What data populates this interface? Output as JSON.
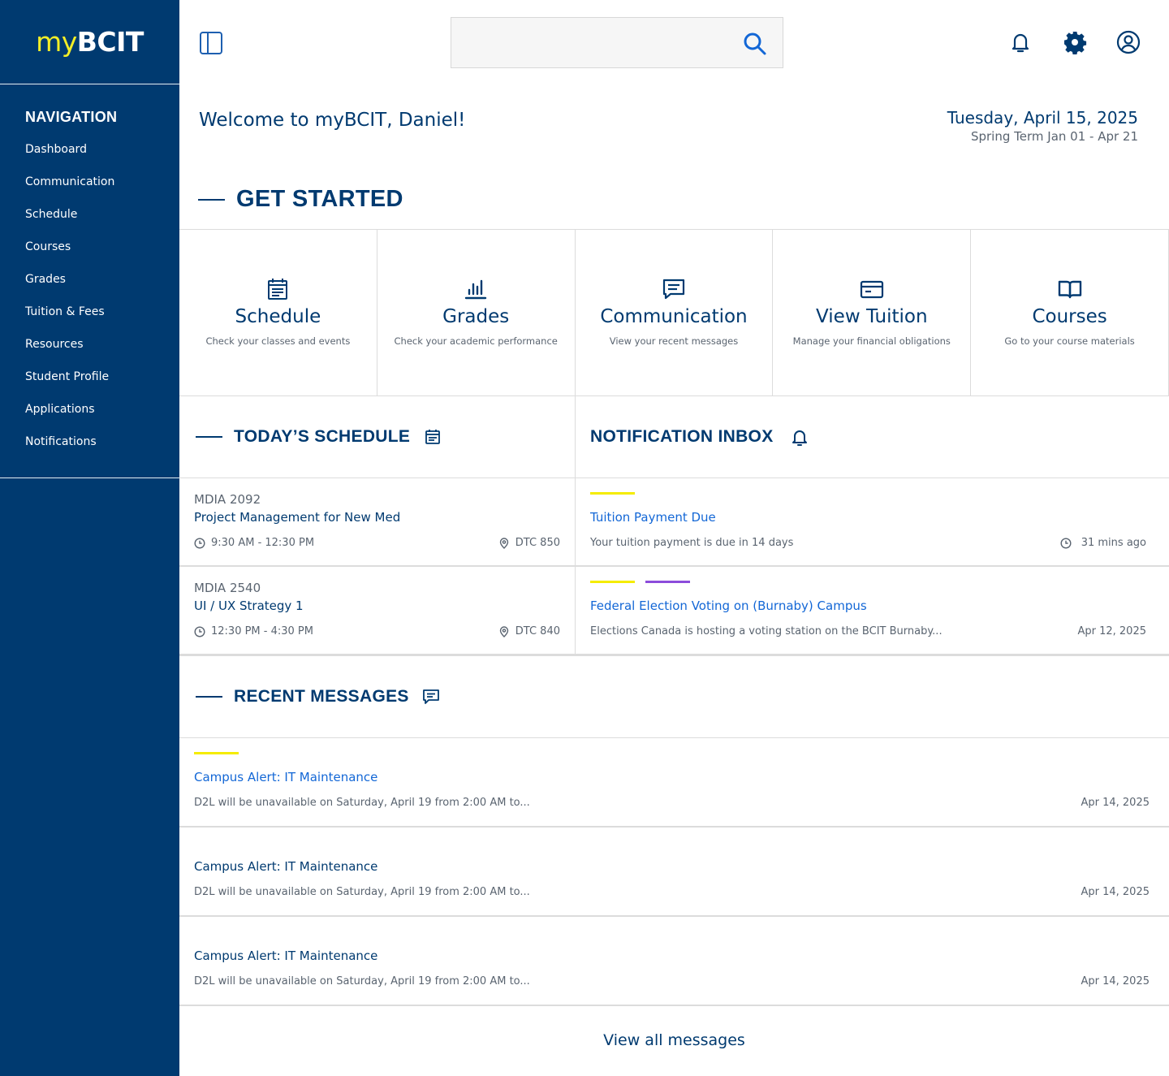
{
  "logo": {
    "my": "my",
    "bcit": "BCIT"
  },
  "nav": {
    "title": "NAVIGATION",
    "items": [
      "Dashboard",
      "Communication",
      "Schedule",
      "Courses",
      "Grades",
      "Tuition & Fees",
      "Resources",
      "Student Profile",
      "Applications",
      "Notifications"
    ]
  },
  "header": {
    "search_placeholder": "",
    "icons": [
      "sidebar-toggle-icon",
      "search-icon",
      "bell-icon",
      "gear-icon",
      "account-icon"
    ]
  },
  "welcome": "Welcome to myBCIT, Daniel!",
  "date": {
    "main": "Tuesday, April  15, 2025",
    "term": "Spring Term Jan 01 - Apr 21"
  },
  "get_started": {
    "title": "GET STARTED",
    "cards": [
      {
        "title": "Schedule",
        "subtitle": "Check your classes and events",
        "icon": "calendar-icon"
      },
      {
        "title": "Grades",
        "subtitle": "Check your academic performance",
        "icon": "bar-chart-icon"
      },
      {
        "title": "Communication",
        "subtitle": "View your recent messages",
        "icon": "message-icon"
      },
      {
        "title": "View Tuition",
        "subtitle": "Manage your financial obligations",
        "icon": "card-icon"
      },
      {
        "title": "Courses",
        "subtitle": "Go to your course materials",
        "icon": "book-icon"
      }
    ]
  },
  "schedule": {
    "title": "TODAY’S SCHEDULE",
    "items": [
      {
        "code": "MDIA 2092",
        "name": "Project Management for New Med",
        "time": "9:30 AM - 12:30 PM",
        "room": "DTC 850"
      },
      {
        "code": "MDIA 2540",
        "name": "UI / UX Strategy 1",
        "time": "12:30 PM - 4:30 PM",
        "room": "DTC 840"
      }
    ]
  },
  "notifications": {
    "title": "NOTIFICATION INBOX",
    "items": [
      {
        "title": "Tuition Payment Due",
        "body": "Your tuition payment is due in 14 days",
        "time": "31 mins ago",
        "tags": [
          "#f5ec00"
        ]
      },
      {
        "title": "Federal Election Voting on (Burnaby) Campus",
        "body": "Elections Canada is hosting a voting station on the BCIT Burnaby...",
        "time": "Apr 12, 2025",
        "tags": [
          "#f5ec00",
          "#8c4cdb"
        ]
      }
    ]
  },
  "messages": {
    "title": "RECENT MESSAGES",
    "items": [
      {
        "title": "Campus Alert: IT Maintenance",
        "body": "D2L will be unavailable on Saturday, April 19 from 2:00 AM to...",
        "date": "Apr 14, 2025",
        "unread": true
      },
      {
        "title": "Campus Alert: IT Maintenance",
        "body": "D2L will be unavailable on Saturday, April 19 from 2:00 AM to...",
        "date": "Apr 14, 2025",
        "unread": false
      },
      {
        "title": "Campus Alert: IT Maintenance",
        "body": "D2L will be unavailable on Saturday, April 19 from 2:00 AM to...",
        "date": "Apr 14, 2025",
        "unread": false
      }
    ],
    "view_all": "View all messages"
  },
  "colors": {
    "primary": "#003a70",
    "accent_yellow": "#f5ec00",
    "accent_purple": "#8c4cdb",
    "link_blue": "#1367d6"
  }
}
